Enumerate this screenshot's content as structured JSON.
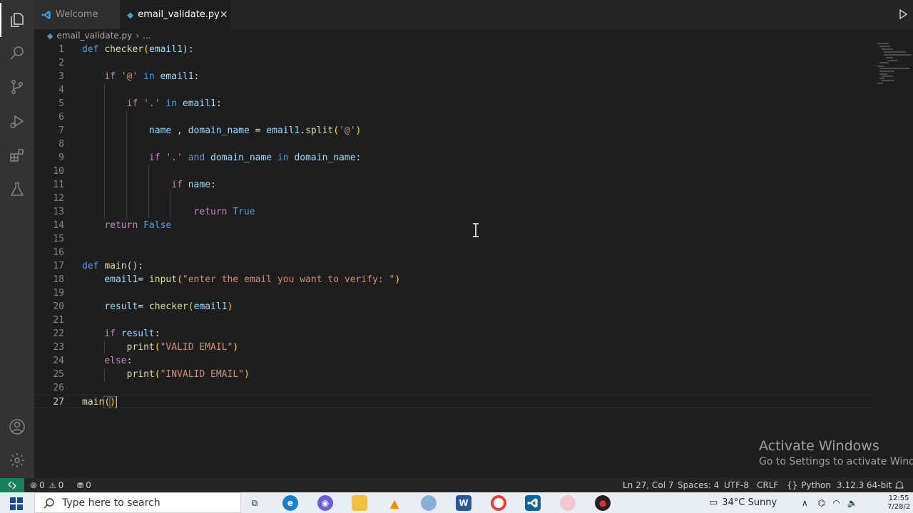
{
  "tabs": [
    {
      "label": "Welcome",
      "active": false
    },
    {
      "label": "email_validate.py",
      "active": true,
      "close": "✕"
    }
  ],
  "breadcrumb": {
    "file": "email_validate.py",
    "more": "..."
  },
  "editor": {
    "line_numbers": [
      "1",
      "2",
      "3",
      "4",
      "5",
      "6",
      "7",
      "8",
      "9",
      "10",
      "11",
      "12",
      "13",
      "14",
      "15",
      "16",
      "17",
      "18",
      "19",
      "20",
      "21",
      "22",
      "23",
      "24",
      "25",
      "26",
      "27"
    ],
    "current_line": 27,
    "code": {
      "l1": {
        "kw": "def",
        "fn": "checker",
        "var": "email1",
        "close": "):"
      },
      "l3": {
        "kw": "if",
        "str": "'@'",
        "in": "in",
        "var": "email1",
        "colon": ":"
      },
      "l5": {
        "kw": "if",
        "str": "'.'",
        "in": "in",
        "var": "email1",
        "colon": ":"
      },
      "l7": {
        "var1": "name",
        "sep": " , ",
        "var2": "domain_name",
        "eq": " = ",
        "var3": "email1",
        "fn": "split",
        "str": "'@'"
      },
      "l9": {
        "kw": "if",
        "str": "'.'",
        "and": "and",
        "var1": "domain_name",
        "in": "in",
        "var2": "domain_name",
        "colon": ":"
      },
      "l11": {
        "kw": "if",
        "var": "name",
        "colon": ":"
      },
      "l13": {
        "ret": "return",
        "val": "True"
      },
      "l14": {
        "ret": "return",
        "val": "False"
      },
      "l17": {
        "kw": "def",
        "fn": "main",
        "close": "():"
      },
      "l18": {
        "var": "email1",
        "eq": "= ",
        "fn": "input",
        "str": "\"enter the email you want to verify: \""
      },
      "l20": {
        "var": "result",
        "eq": "= ",
        "fn": "checker",
        "arg": "email1"
      },
      "l22": {
        "kw": "if",
        "var": "result",
        "colon": ":"
      },
      "l23": {
        "fn": "print",
        "str": "\"VALID EMAIL\""
      },
      "l24": {
        "kw": "else",
        "colon": ":"
      },
      "l25": {
        "fn": "print",
        "str": "\"INVALID EMAIL\""
      },
      "l27": {
        "fn": "main"
      }
    }
  },
  "watermark": {
    "title": "Activate Windows",
    "subtitle": "Go to Settings to activate Windows."
  },
  "statusbar": {
    "errors": "0",
    "warnings": "0",
    "ports": "0",
    "position": "Ln 27, Col 7",
    "spaces": "Spaces: 4",
    "encoding": "UTF-8",
    "eol": "CRLF",
    "language": "Python",
    "interpreter": "3.12.3 64-bit"
  },
  "taskbar": {
    "search_placeholder": "Type here to search",
    "weather": "34°C  Sunny",
    "time": "12:55",
    "date": "7/28/2"
  },
  "colors": {
    "accent": "#007acc",
    "remote": "#16825d",
    "keyword": "#569cd6",
    "control": "#c586c0",
    "function": "#dcdcaa",
    "variable": "#9cdcfe",
    "string": "#ce9178"
  },
  "icons": [
    "explorer-icon",
    "search-icon",
    "source-control-icon",
    "run-debug-icon",
    "extensions-icon",
    "testing-icon",
    "accounts-icon",
    "manage-gear-icon",
    "vscode-icon",
    "python-file-icon",
    "close-icon",
    "run-icon",
    "error-icon",
    "warning-icon",
    "ports-icon",
    "windows-start-icon"
  ]
}
